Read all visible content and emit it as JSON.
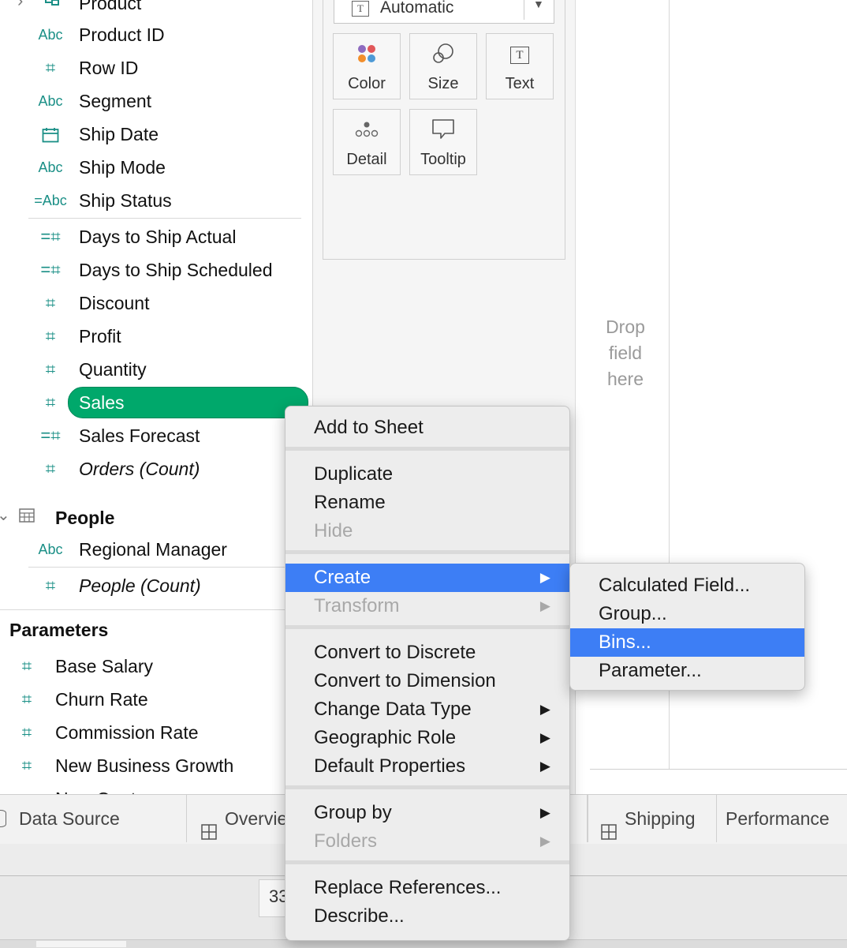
{
  "data_pane": {
    "top_partial_field": "Product",
    "fields": [
      {
        "icon": "Abc",
        "label": "Product ID",
        "italic": false,
        "icon_name": "string-icon"
      },
      {
        "icon": "#",
        "label": "Row ID",
        "italic": false,
        "icon_name": "number-icon"
      },
      {
        "icon": "Abc",
        "label": "Segment",
        "italic": false,
        "icon_name": "string-icon"
      },
      {
        "icon": "",
        "label": "Ship Date",
        "italic": false,
        "icon_name": "calendar-icon"
      },
      {
        "icon": "Abc",
        "label": "Ship Mode",
        "italic": false,
        "icon_name": "string-icon"
      },
      {
        "icon": "=Abc",
        "label": "Ship Status",
        "italic": false,
        "icon_name": "calculated-string-icon"
      },
      {
        "icon": "=#",
        "label": "Days to Ship Actual",
        "italic": false,
        "icon_name": "calculated-number-icon"
      },
      {
        "icon": "=#",
        "label": "Days to Ship Scheduled",
        "italic": false,
        "icon_name": "calculated-number-icon"
      },
      {
        "icon": "#",
        "label": "Discount",
        "italic": false,
        "icon_name": "number-icon"
      },
      {
        "icon": "#",
        "label": "Profit",
        "italic": false,
        "icon_name": "number-icon"
      },
      {
        "icon": "#",
        "label": "Quantity",
        "italic": false,
        "icon_name": "number-icon"
      },
      {
        "icon": "#",
        "label": "Sales",
        "italic": false,
        "icon_name": "number-icon",
        "selected": true
      },
      {
        "icon": "=#",
        "label": "Sales Forecast",
        "italic": false,
        "icon_name": "calculated-number-icon"
      },
      {
        "icon": "#",
        "label": "Orders (Count)",
        "italic": true,
        "icon_name": "number-icon"
      }
    ],
    "people_table": "People",
    "people_fields": [
      {
        "icon": "Abc",
        "label": "Regional Manager",
        "italic": false
      },
      {
        "icon": "#",
        "label": "People (Count)",
        "italic": true
      }
    ],
    "parameters_header": "Parameters",
    "parameters": [
      {
        "icon": "#",
        "label": "Base Salary"
      },
      {
        "icon": "#",
        "label": "Churn Rate"
      },
      {
        "icon": "#",
        "label": "Commission Rate"
      },
      {
        "icon": "#",
        "label": "New Business Growth"
      },
      {
        "icon": "#",
        "label": "New Quota"
      }
    ],
    "selected_color": "#00a86b"
  },
  "marks": {
    "mark_type": "Automatic",
    "buttons": [
      {
        "label": "Color",
        "icon": "color-icon"
      },
      {
        "label": "Size",
        "icon": "size-icon"
      },
      {
        "label": "Text",
        "icon": "text-icon"
      },
      {
        "label": "Detail",
        "icon": "detail-icon"
      },
      {
        "label": "Tooltip",
        "icon": "tooltip-icon"
      }
    ]
  },
  "view": {
    "drop_hint_lines": [
      "Drop",
      "field",
      "here"
    ]
  },
  "tabs": [
    {
      "label": "Data Source",
      "icon": "datasource-icon"
    },
    {
      "label": "Overview",
      "icon": "dashboard-icon"
    },
    {
      "label": "Shipping",
      "icon": "dashboard-icon"
    },
    {
      "label": "Performance",
      "icon": ""
    }
  ],
  "status_partial": "33",
  "context_menu": {
    "groups": [
      [
        {
          "label": "Add to Sheet"
        }
      ],
      [
        {
          "label": "Duplicate"
        },
        {
          "label": "Rename"
        },
        {
          "label": "Hide",
          "disabled": true
        }
      ],
      [
        {
          "label": "Create",
          "submenu": true,
          "highlighted": true
        },
        {
          "label": "Transform",
          "submenu": true,
          "disabled": true
        }
      ],
      [
        {
          "label": "Convert to Discrete"
        },
        {
          "label": "Convert to Dimension"
        },
        {
          "label": "Change Data Type",
          "submenu": true
        },
        {
          "label": "Geographic Role",
          "submenu": true
        },
        {
          "label": "Default Properties",
          "submenu": true
        }
      ],
      [
        {
          "label": "Group by",
          "submenu": true
        },
        {
          "label": "Folders",
          "submenu": true,
          "disabled": true
        }
      ],
      [
        {
          "label": "Replace References..."
        },
        {
          "label": "Describe..."
        }
      ]
    ]
  },
  "submenu": {
    "items": [
      {
        "label": "Calculated Field..."
      },
      {
        "label": "Group..."
      },
      {
        "label": "Bins...",
        "highlighted": true
      },
      {
        "label": "Parameter..."
      }
    ]
  },
  "highlight_color": "#3d7ef5"
}
